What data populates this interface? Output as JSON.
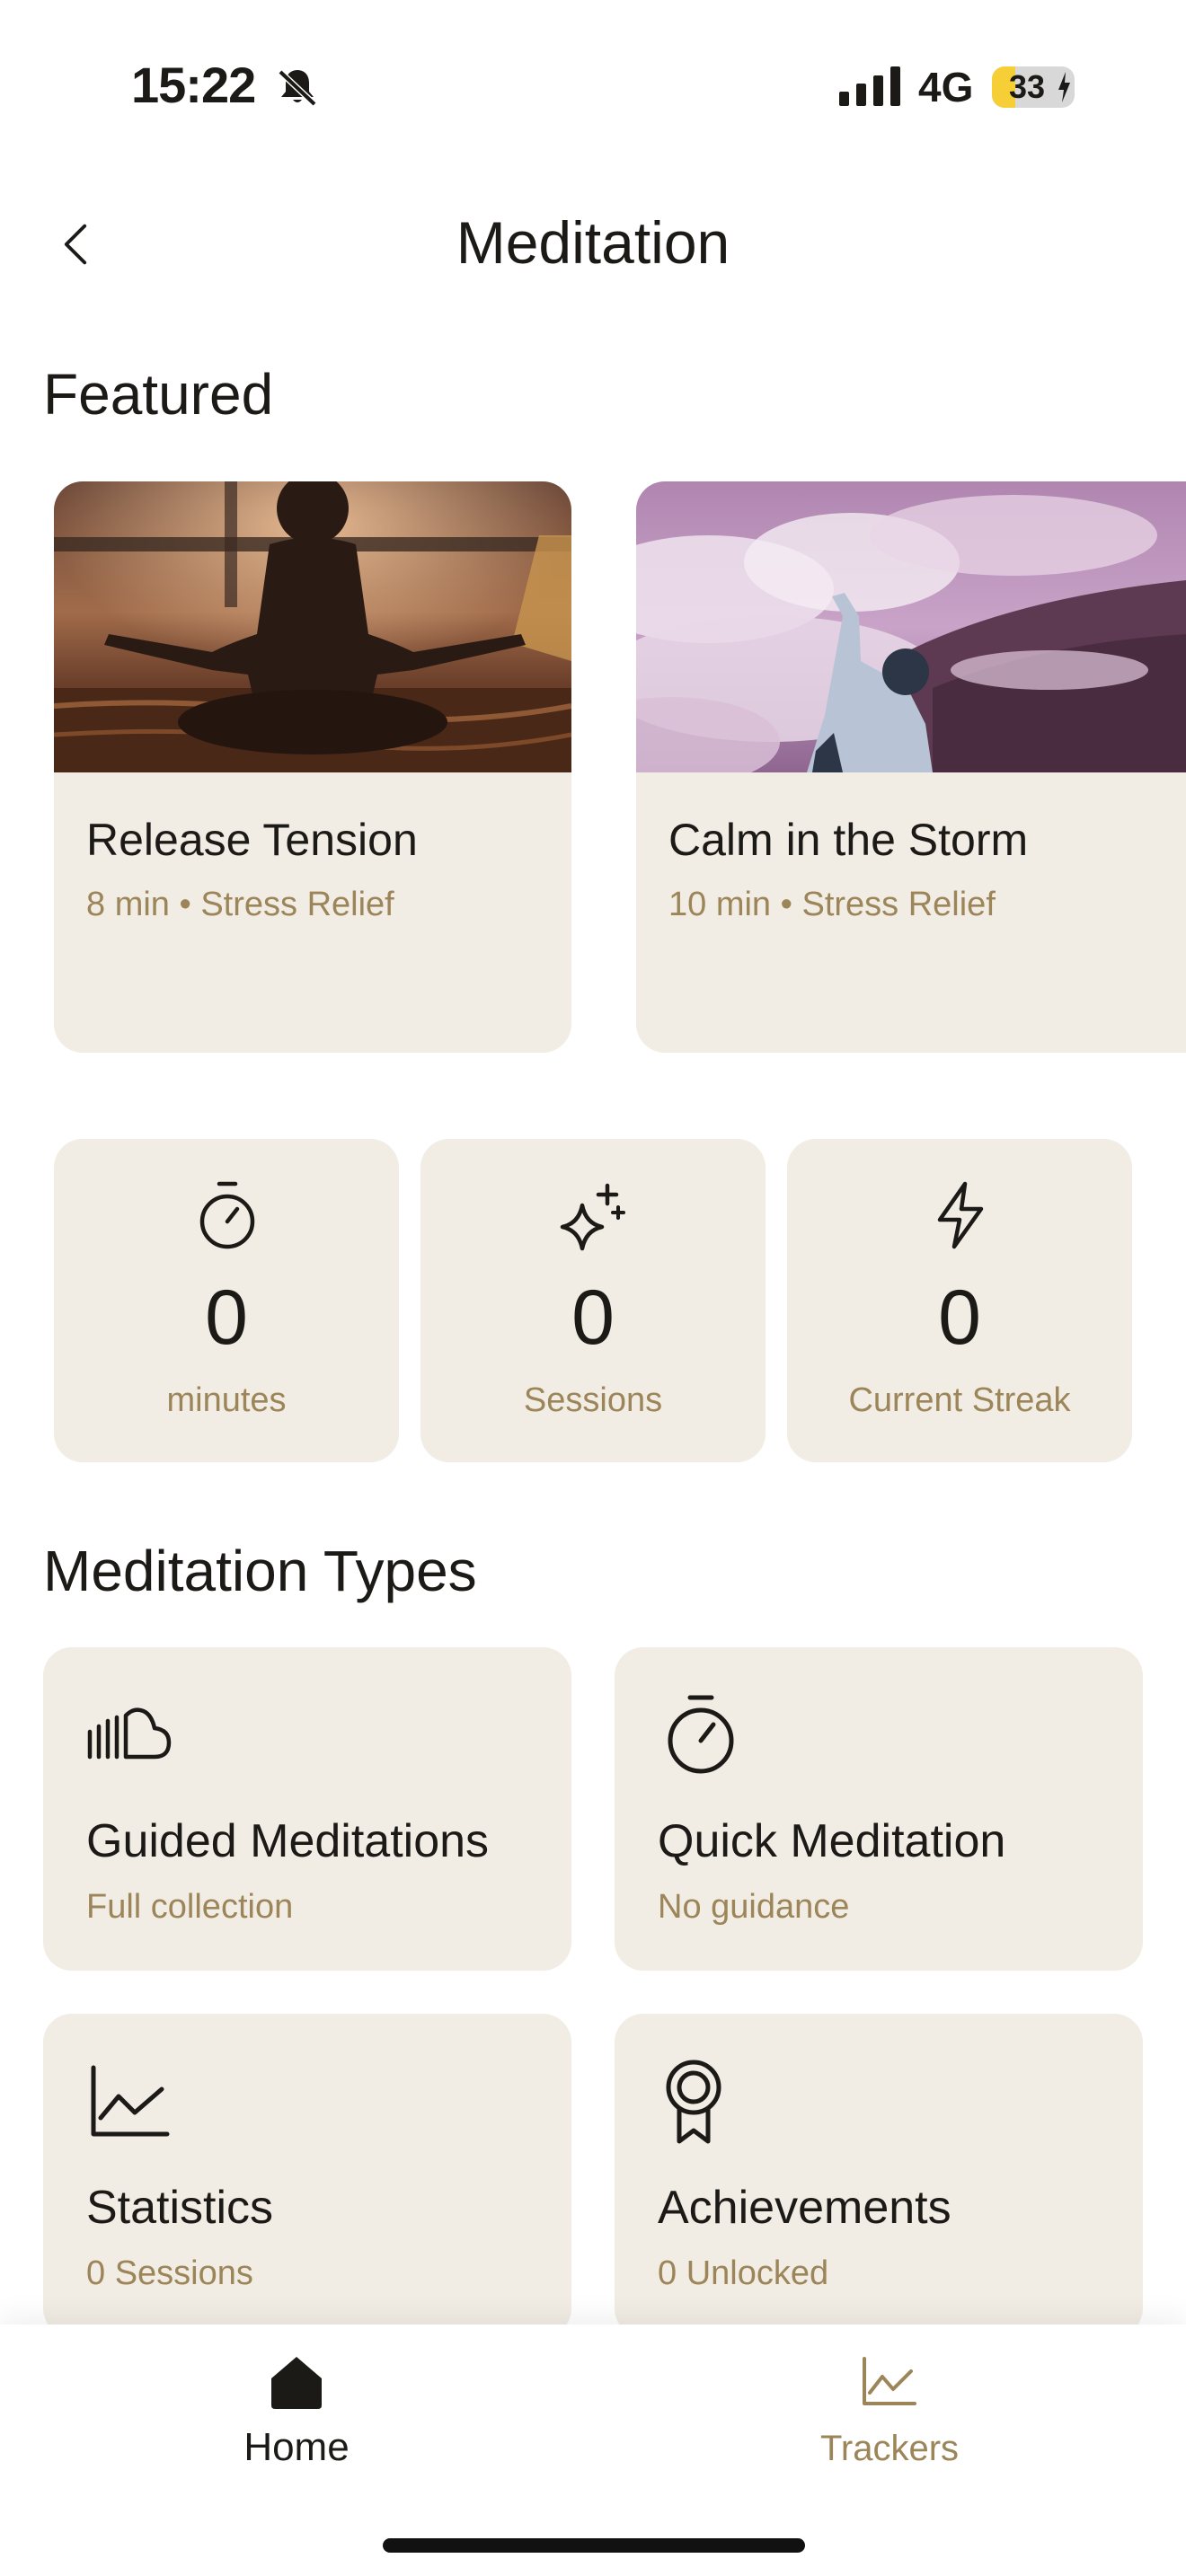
{
  "status_bar": {
    "time": "15:22",
    "network": "4G",
    "battery_percent": 33,
    "battery_label": "33"
  },
  "header": {
    "title": "Meditation",
    "back_icon": "chevron-left-icon"
  },
  "featured": {
    "title": "Featured",
    "cards": [
      {
        "name": "Release Tension",
        "meta": "8 min • Stress Relief"
      },
      {
        "name": "Calm in the Storm",
        "meta": "10 min • Stress Relief"
      }
    ]
  },
  "stats": [
    {
      "icon": "stopwatch-icon",
      "value": "0",
      "label": "minutes"
    },
    {
      "icon": "sparkles-icon",
      "value": "0",
      "label": "Sessions"
    },
    {
      "icon": "lightning-icon",
      "value": "0",
      "label": "Current Streak"
    }
  ],
  "types": {
    "title": "Meditation Types",
    "cards": [
      {
        "icon": "soundcloud-icon",
        "name": "Guided Meditations",
        "subtitle": "Full collection"
      },
      {
        "icon": "stopwatch-icon",
        "name": "Quick Meditation",
        "subtitle": "No guidance"
      },
      {
        "icon": "line-chart-icon",
        "name": "Statistics",
        "subtitle": "0 Sessions"
      },
      {
        "icon": "award-icon",
        "name": "Achievements",
        "subtitle": "0 Unlocked"
      }
    ]
  },
  "tab_bar": {
    "home_label": "Home",
    "trackers_label": "Trackers"
  },
  "colors": {
    "card_bg": "#f1ece4",
    "accent_text": "#9c8558",
    "primary_text": "#1c1a17",
    "battery_yellow": "#f6cf36"
  }
}
